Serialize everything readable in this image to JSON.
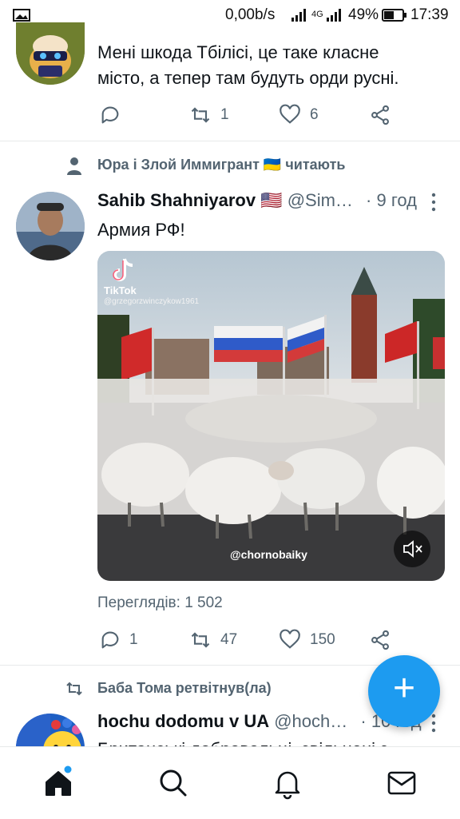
{
  "status_bar": {
    "net_speed": "0,00b/s",
    "battery": "49%",
    "time": "17:39",
    "network_type": "4G"
  },
  "tweet1": {
    "text_line1": "Мені шкода Тбілісі, це таке класне",
    "text_line2": "місто, а тепер там будуть орди русні.",
    "retweets": "1",
    "likes": "6"
  },
  "tweet2": {
    "social_context": "Юра і Злой Иммигрант 🇺🇦 читають",
    "author_name": "Sahib Shahniyarov 🇺🇸",
    "handle": "@Sim…",
    "time": "· 9 год",
    "text": "Армия РФ!",
    "video": {
      "tiktok_label": "TikTok",
      "tiktok_user": "@grzegorzwinczykow1961",
      "watermark": "@chornobaiky"
    },
    "views": "Переглядів: 1 502",
    "replies": "1",
    "retweets": "47",
    "likes": "150"
  },
  "tweet3": {
    "retweet_context": "Баба Тома ретвітнув(ла)",
    "author_name": "hochu dodomu v UA",
    "handle": "@hoch…",
    "time": "· 10 год",
    "text_partial": "Британські добровольці, звільнені з"
  },
  "fab": {
    "label": "+"
  },
  "colors": {
    "accent": "#1d9bf0",
    "muted": "#536471",
    "text": "#0f1419"
  }
}
